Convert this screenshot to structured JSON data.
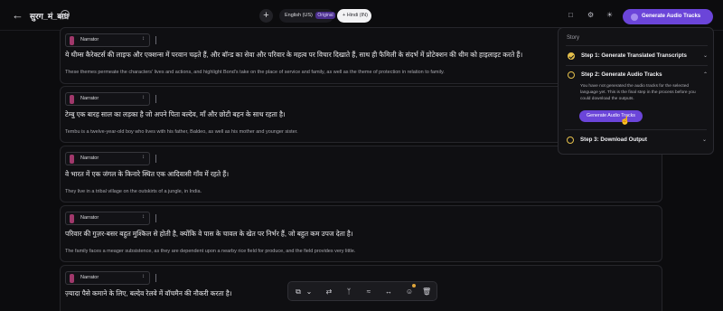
{
  "header": {
    "back_icon": "arrow-left-icon",
    "title": "सुरग_मं_बाघ",
    "history_icon": "history-icon",
    "add_language_icon": "plus-icon",
    "source_language": "English (US)",
    "source_badge": "Original",
    "target_language": "+ Hindi (IN)",
    "generate_button": "Generate Audio Tracks"
  },
  "segments": [
    {
      "speaker": "Narrator",
      "hindi": "ये थीम्स कैरेक्टर्स की लाइफ और एक्शन्स में परवान चढ़ते हैं, और बॉन्ड का सेवा और परिवार के महत्व पर विचार दिखाते हैं, साथ ही फैमिली के संदर्भ में प्रोटेक्शन की थीम को हाइलाइट करते हैं।",
      "english": "These themes permeate the characters' lives and actions, and highlight Bond's take on the place of service and family, as well as the theme of protection in relation to family."
    },
    {
      "speaker": "Narrator",
      "hindi": "टेम्बु एक बारह साल का लड़का है जो अपने पिता बल्देव, माँ और छोटी बहन के साथ रहता है।",
      "english": "Tembu is a twelve-year-old boy who lives with his father, Baldeo, as well as his mother and younger sister."
    },
    {
      "speaker": "Narrator",
      "hindi": "वे भारत में एक जंगल के किनारे स्थित एक आदिवासी गाँव में रहते हैं।",
      "english": "They live in a tribal village on the outskirts of a jungle, in India."
    },
    {
      "speaker": "Narrator",
      "hindi": "परिवार की गुज़र-बसर बहुत मुश्किल से होती है, क्योंकि वे पास के चावल के खेत पर निर्भर हैं, जो बहुत कम उपज देता है।",
      "english": "The family faces a meager subsistence, as they are dependent upon a nearby rice field for produce, and the field provides very little."
    },
    {
      "speaker": "Narrator",
      "hindi": "ज़्यादा पैसे कमाने के लिए, बल्देव रेलवे में वॉचमैन की नौकरी करता है।",
      "english": ""
    }
  ],
  "story_panel": {
    "label": "Story",
    "steps": [
      {
        "label": "Step 1: Generate Translated Transcripts",
        "status": "done"
      },
      {
        "label": "Step 2: Generate Audio Tracks",
        "status": "current"
      },
      {
        "label": "Step 3: Download Output",
        "status": "pending"
      }
    ],
    "step2_description": "You have not generated the audio tracks for the selected language yet. This is the final step in the process before you could download the outputs.",
    "step2_button": "Generate Audio Tracks"
  },
  "toolbar": {
    "tools": [
      "copy-icon",
      "chevron-down-icon",
      "translate-icon",
      "merge-icon",
      "voice-icon",
      "spacing-icon",
      "emotion-icon",
      "trash-icon"
    ]
  },
  "colors": {
    "accent": "#6b45d9",
    "step_yellow": "#e5c04c",
    "speaker_swatch": "#a0386b"
  }
}
